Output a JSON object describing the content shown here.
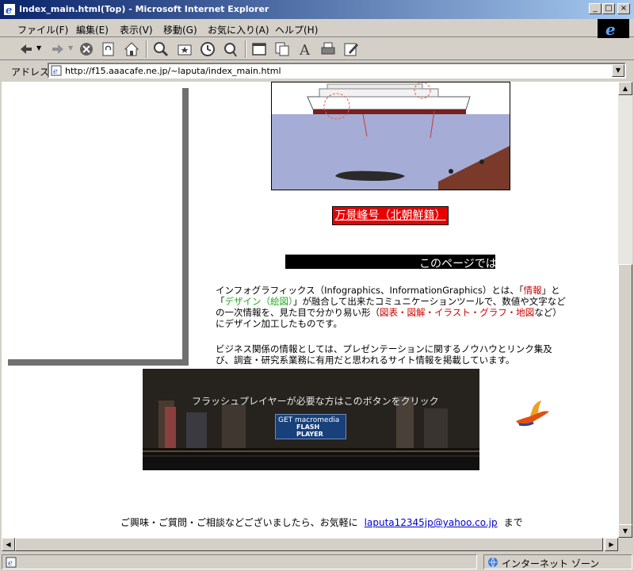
{
  "window": {
    "title": "Index_main.html(Top) - Microsoft Internet Explorer"
  },
  "menu": {
    "items": [
      "ファイル(F)",
      "編集(E)",
      "表示(V)",
      "移動(G)",
      "お気に入り(A)",
      "ヘルプ(H)"
    ]
  },
  "address": {
    "label": "アドレス",
    "url": "http://f15.aaacafe.ne.jp/~laputa/index_main.html"
  },
  "content": {
    "ship_link": "万景峰号（北朝鮮籍）",
    "marquee_text": "このページでは",
    "para1_parts": [
      "インフォグラフィックス（Infographics、InformationGraphics）とは、「",
      "情報",
      "」と「",
      "デザイン（絵図）",
      "」が融合して出来たコミュニケーションツールで、数値や文字などの一次情報を、見た目で分かり易い形（",
      "図表・図解・イラスト・グラフ・地図",
      "など）にデザイン加工したものです。"
    ],
    "para2": "ビジネス関係の情報としては、プレゼンテーションに関するノウハウとリンク集及び、調査・研究系業務に有用だと思われるサイト情報を掲載しています。",
    "flash_message": "フラッシュプレイヤーが必要な方はこのボタンをクリック",
    "flash_button": {
      "line1": "GET macromedia",
      "line2": "FLASH",
      "line3": "PLAYER"
    },
    "footer_text": "ご興味・ご質問・ご相談などございましたら、お気軽に",
    "footer_email": "laputa12345jp@yahoo.co.jp",
    "footer_suffix": "まで"
  },
  "status": {
    "zone": "インターネット ゾーン"
  },
  "icons": [
    "ie-logo-icon",
    "back-icon",
    "forward-icon",
    "stop-icon",
    "refresh-icon",
    "home-icon",
    "search-icon",
    "favorites-icon",
    "history-icon",
    "mail-icon",
    "print-icon",
    "edit-icon",
    "page-icon",
    "globe-icon",
    "bird-icon"
  ]
}
